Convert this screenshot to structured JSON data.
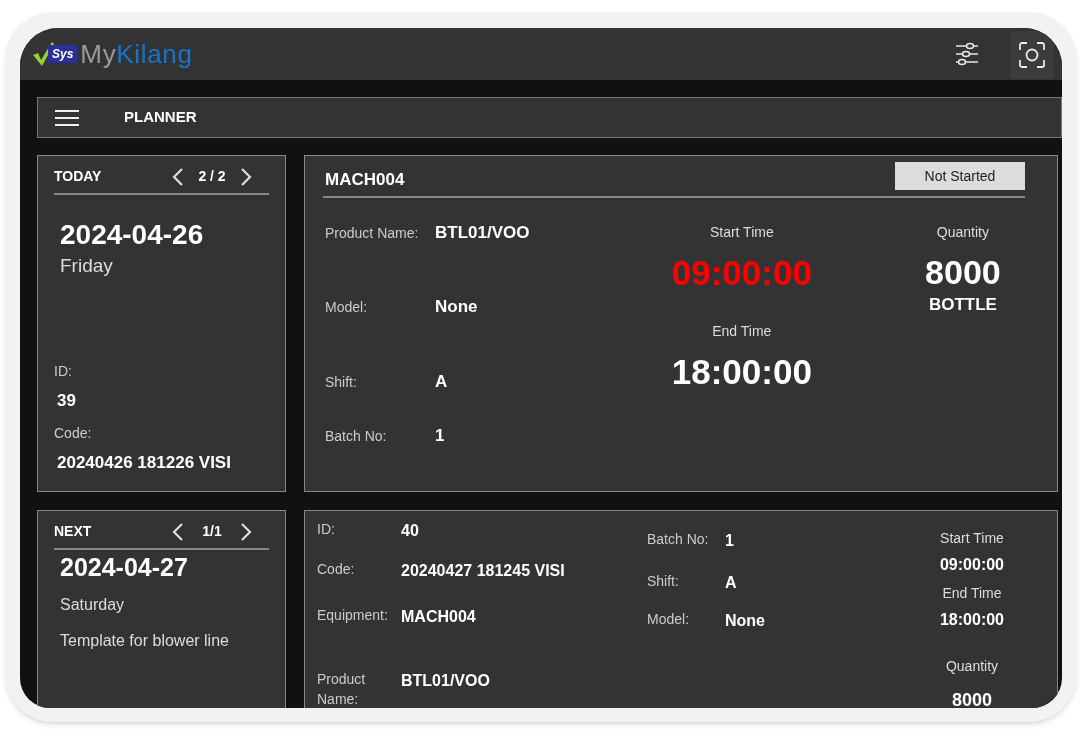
{
  "header": {
    "logo": {
      "badge": "Sys",
      "name_part_1": "My",
      "name_part_2": "Kilang"
    }
  },
  "toolbar": {
    "title": "PLANNER"
  },
  "today": {
    "heading": "TODAY",
    "pager": "2 / 2",
    "date": "2024-04-26",
    "weekday": "Friday",
    "fields": [
      {
        "label": "ID:",
        "value": "39"
      },
      {
        "label": "Code:",
        "value": "20240426 181226 VISI"
      }
    ]
  },
  "current_job": {
    "machine": "MACH004",
    "status": "Not Started",
    "fields": [
      {
        "label": "Product Name:",
        "value": "BTL01/VOO"
      },
      {
        "label": "Model:",
        "value": "None"
      },
      {
        "label": "Shift:",
        "value": "A"
      },
      {
        "label": "Batch No:",
        "value": "1"
      }
    ],
    "start_time": {
      "label": "Start Time",
      "value": "09:00:00",
      "highlighted": true
    },
    "end_time": {
      "label": "End Time",
      "value": "18:00:00",
      "highlighted": false
    },
    "quantity": {
      "label": "Quantity",
      "value": "8000",
      "unit": "BOTTLE"
    }
  },
  "next": {
    "heading": "NEXT",
    "pager": "1/1",
    "date": "2024-04-27",
    "weekday": "Saturday",
    "description": "Template for blower line"
  },
  "next_job": {
    "fields_left": [
      {
        "label": "ID:",
        "value": "40"
      },
      {
        "label": "Code:",
        "value": "20240427 181245 VISI"
      },
      {
        "label": "Equipment:",
        "value": "MACH004"
      },
      {
        "label": "Product Name:",
        "value": "BTL01/VOO"
      }
    ],
    "fields_middle": [
      {
        "label": "Batch No:",
        "value": "1"
      },
      {
        "label": "Shift:",
        "value": "A"
      },
      {
        "label": "Model:",
        "value": "None"
      }
    ],
    "start_time": {
      "label": "Start Time",
      "value": "09:00:00"
    },
    "end_time": {
      "label": "End Time",
      "value": "18:00:00"
    },
    "quantity": {
      "label": "Quantity",
      "value": "8000"
    }
  }
}
